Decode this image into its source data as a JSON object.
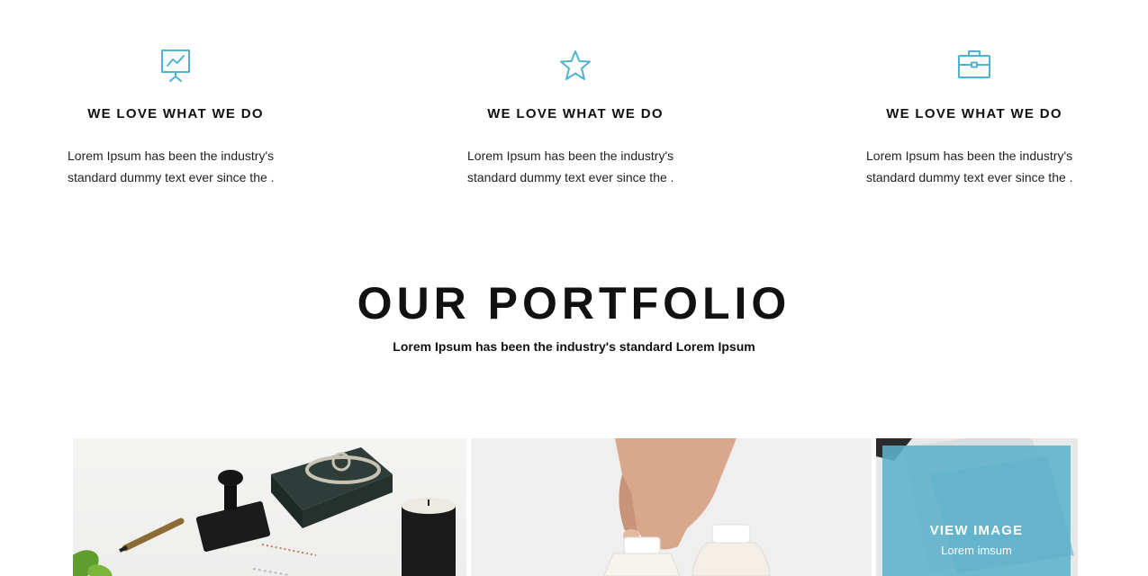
{
  "features": [
    {
      "icon": "presentation-chart-icon",
      "title": "WE LOVE WHAT WE DO",
      "text": "Lorem Ipsum has been the industry's standard dummy text ever since the ."
    },
    {
      "icon": "star-icon",
      "title": "WE LOVE WHAT WE DO",
      "text": "Lorem Ipsum has been the industry's standard dummy text ever since the ."
    },
    {
      "icon": "briefcase-icon",
      "title": "WE LOVE WHAT WE DO",
      "text": "Lorem Ipsum has been the industry's standard dummy text ever since the ."
    }
  ],
  "portfolio": {
    "title": "OUR PORTFOLIO",
    "subtitle": "Lorem Ipsum has been the industry's standard Lorem Ipsum",
    "items": [
      {
        "image": "stationery-mockup-image"
      },
      {
        "image": "milk-bottles-image"
      },
      {
        "image": "business-cards-image",
        "overlay_title": "VIEW IMAGE",
        "overlay_subtitle": "Lorem imsum"
      }
    ]
  },
  "colors": {
    "accent": "#4fb3cf",
    "overlay": "#5cb2cc",
    "text": "#111111"
  }
}
